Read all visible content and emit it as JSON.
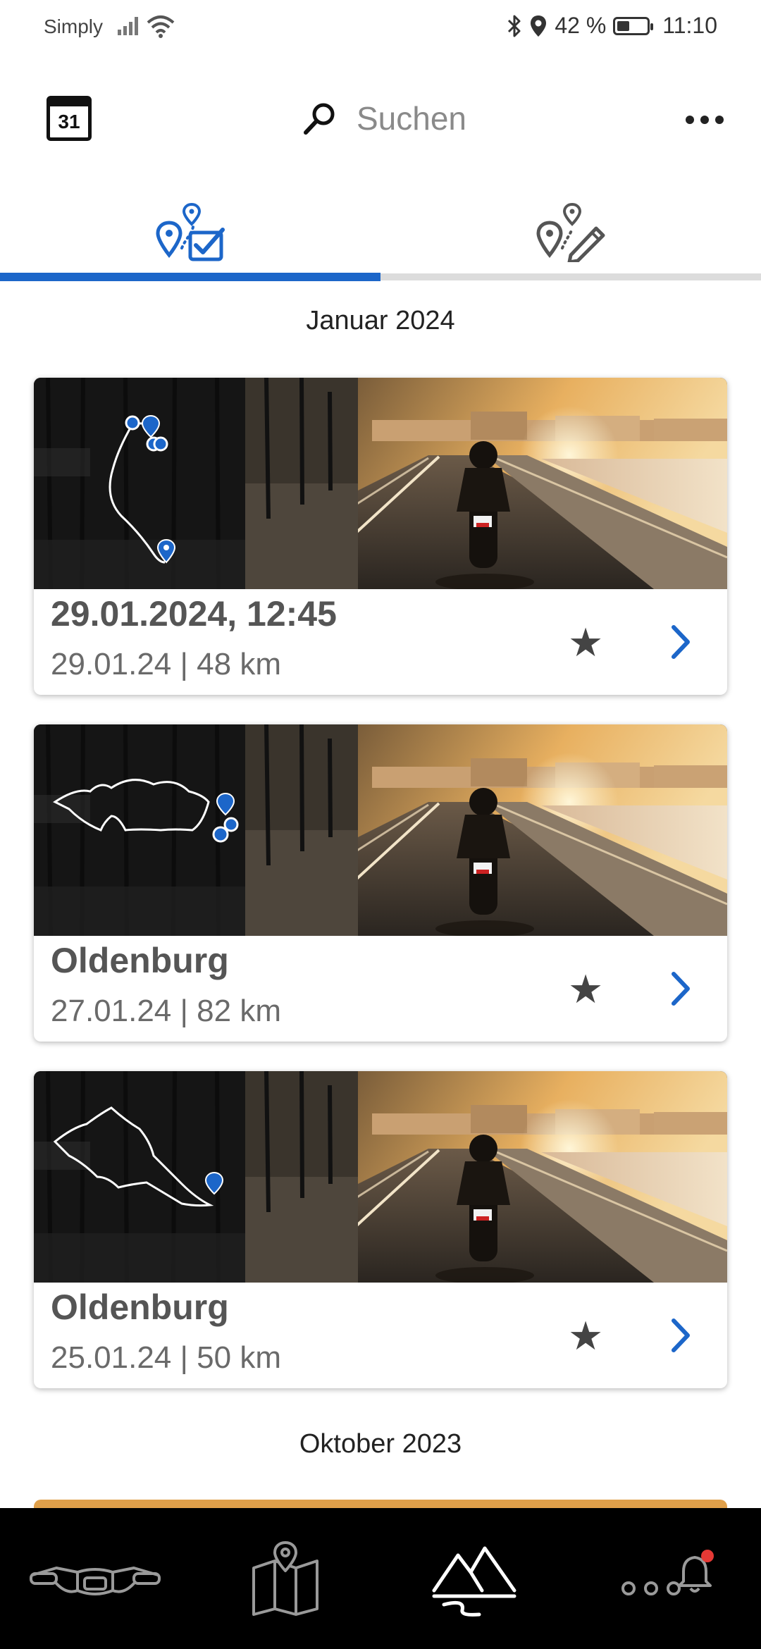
{
  "status_bar": {
    "carrier": "Simply",
    "battery": "42 %",
    "battery_level": 0.42,
    "time": "11:10"
  },
  "app_bar": {
    "calendar_day": "31",
    "search_placeholder": "Suchen"
  },
  "tabs": [
    {
      "icon": "recorded-routes-icon",
      "active": true
    },
    {
      "icon": "planned-routes-icon",
      "active": false
    }
  ],
  "sections": [
    {
      "title": "Januar 2024",
      "rides": [
        {
          "title": "29.01.2024, 12:45",
          "subtitle": "29.01.24 | 48 km"
        },
        {
          "title": "Oldenburg",
          "subtitle": "27.01.24 | 82 km"
        },
        {
          "title": "Oldenburg",
          "subtitle": "25.01.24 | 50 km"
        }
      ]
    },
    {
      "title": "Oktober 2023",
      "rides": []
    }
  ],
  "bottom_nav": [
    {
      "icon": "motorcycle-icon",
      "active": false
    },
    {
      "icon": "map-icon",
      "active": false
    },
    {
      "icon": "mountain-routes-icon",
      "active": true
    },
    {
      "icon": "more-notifications-icon",
      "active": false
    }
  ],
  "colors": {
    "accent": "#1c66c9",
    "nav_background": "#000000",
    "notification_dot": "#e53935"
  }
}
